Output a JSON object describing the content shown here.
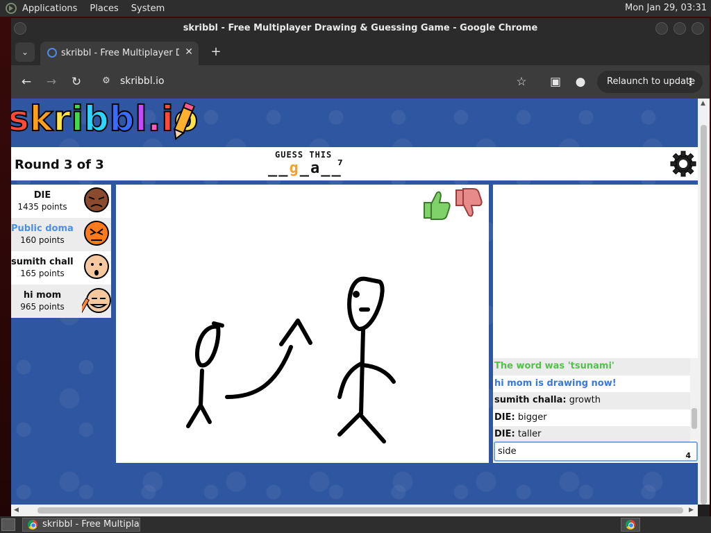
{
  "system_panel": {
    "menus": [
      "Applications",
      "Places",
      "System"
    ],
    "clock": "Mon Jan 29, 03:31"
  },
  "window": {
    "title": "skribbl - Free Multiplayer Drawing & Guessing Game - Google Chrome"
  },
  "browser": {
    "tab_title": "skribbl - Free Multiplayer Drawing & Guessing Game",
    "url": "skribbl.io",
    "relaunch_label": "Relaunch to update"
  },
  "game": {
    "logo_text": "skribbl.io",
    "round": "Round 3 of 3",
    "guess_label": "GUESS THIS",
    "word_pattern": [
      "_",
      "_",
      "g",
      "_",
      "a",
      "_",
      "_"
    ],
    "word_length": "7",
    "players": [
      {
        "name": "DIE",
        "points": "1435 points"
      },
      {
        "name": "Public domain (You)",
        "points": "160 points"
      },
      {
        "name": "sumith challa",
        "points": "165 points"
      },
      {
        "name": "hi mom",
        "points": "965 points"
      }
    ],
    "chat": [
      {
        "type": "system-green",
        "text": "The word was 'tsunami'"
      },
      {
        "type": "system-blue",
        "text": "hi mom is drawing now!"
      },
      {
        "type": "message",
        "author": "sumith challa:",
        "text": " growth"
      },
      {
        "type": "message",
        "author": "DIE:",
        "text": " bigger"
      },
      {
        "type": "message",
        "author": "DIE:",
        "text": " taller"
      }
    ],
    "chat_input_value": "side",
    "chat_input_count": "4"
  },
  "taskbar": {
    "item_label": "skribbl - Free Multiplayer Drawing & Guessing Game - Google Chrome"
  },
  "colors": {
    "page_bg": "#2f56a0",
    "hint_letter": "#f7a12b",
    "chat_green": "#52c24a",
    "chat_blue": "#3a78d8",
    "you_name": "#4a8fe7"
  }
}
